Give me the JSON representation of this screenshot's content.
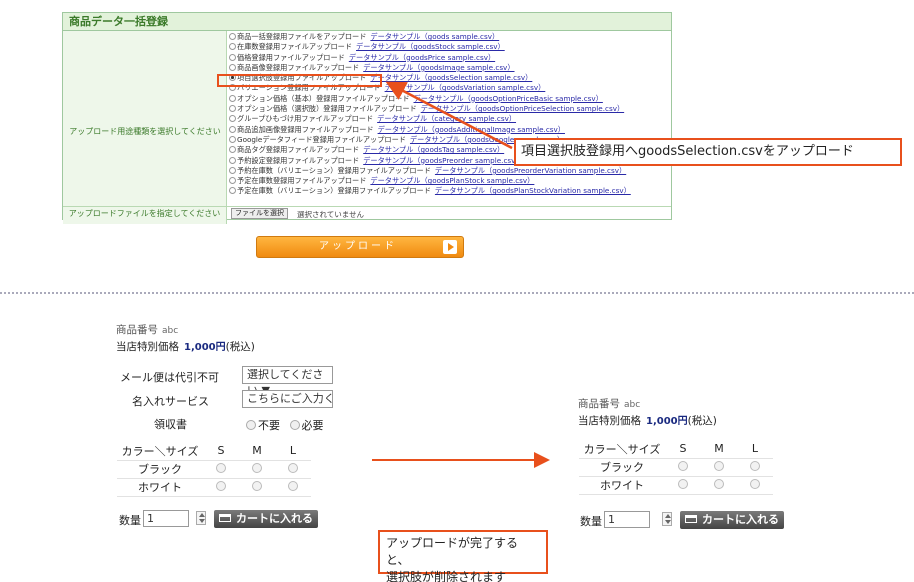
{
  "upload_panel": {
    "title": "商品データ一括登録",
    "type_label": "アップロード用途種類を選択してください",
    "options": [
      {
        "label": "商品一括登録用ファイルをアップロード",
        "link": "データサンプル（goods sample.csv）",
        "selected": false
      },
      {
        "label": "在庫数登録用ファイルアップロード",
        "link": "データサンプル（goodsStock sample.csv）",
        "selected": false
      },
      {
        "label": "価格登録用ファイルアップロード",
        "link": "データサンプル（goodsPrice sample.csv）",
        "selected": false
      },
      {
        "label": "商品画像登録用ファイルアップロード",
        "link": "データサンプル（goodsImage sample.csv）",
        "selected": false
      },
      {
        "label": "項目選択肢登録用ファイルアップロード",
        "link": "データサンプル（goodsSelection sample.csv）",
        "selected": true
      },
      {
        "label": "バリエーション登録用ファイルアップロード",
        "link": "データサンプル（goodsVariation sample.csv）",
        "selected": false
      },
      {
        "label": "オプション価格（基本）登録用ファイルアップロード",
        "link": "データサンプル（goodsOptionPriceBasic sample.csv）",
        "selected": false
      },
      {
        "label": "オプション価格（選択肢）登録用ファイルアップロード",
        "link": "データサンプル（goodsOptionPriceSelection sample.csv）",
        "selected": false
      },
      {
        "label": "グループひもづけ用ファイルアップロード",
        "link": "データサンプル（category sample.csv）",
        "selected": false
      },
      {
        "label": "商品追加画像登録用ファイルアップロード",
        "link": "データサンプル（goodsAdditionalImage sample.csv）",
        "selected": false
      },
      {
        "label": "Googleデータフィード登録用ファイルアップロード",
        "link": "データサンプル（goodsGoogle sample.csv）",
        "selected": false
      },
      {
        "label": "商品タグ登録用ファイルアップロード",
        "link": "データサンプル（goodsTag sample.csv）",
        "selected": false
      },
      {
        "label": "予約設定登録用ファイルアップロード",
        "link": "データサンプル（goodsPreorder sample.csv）",
        "selected": false
      },
      {
        "label": "予約在庫数（バリエーション）登録用ファイルアップロード",
        "link": "データサンプル（goodsPreorderVariation sample.csv）",
        "selected": false
      },
      {
        "label": "予定在庫数登録用ファイルアップロード",
        "link": "データサンプル（goodsPlanStock sample.csv）",
        "selected": false
      },
      {
        "label": "予定在庫数（バリエーション）登録用ファイルアップロード",
        "link": "データサンプル（goodsPlanStockVariation sample.csv）",
        "selected": false
      }
    ],
    "file_label": "アップロードファイルを指定してください",
    "file_button": "ファイルを選択",
    "file_status": "選択されていません",
    "upload_button": "アップロード"
  },
  "callout_top": "項目選択肢登録用へgoodsSelection.csvをアップロード",
  "callout_bottom": {
    "line1": "アップロードが完了すると、",
    "line2": "選択肢が削除されます"
  },
  "before": {
    "product_number_label": "商品番号",
    "product_number": "abc",
    "price_label": "当店特別価格",
    "price_value": "1,000円",
    "tax_note": "(税込)",
    "mail_label": "メール便は代引不可",
    "mail_select": "選択してください",
    "engrave_label": "名入れサービス",
    "engrave_value": "こちらにご入力くだ",
    "receipt_label": "領収書",
    "receipt_no": "不要",
    "receipt_yes": "必要",
    "matrix_header": "カラー＼サイズ",
    "sizes": [
      "S",
      "M",
      "L"
    ],
    "colors": [
      "ブラック",
      "ホワイト"
    ],
    "qty_label": "数量",
    "qty_value": "1",
    "cart_button": "カートに入れる"
  },
  "after": {
    "product_number_label": "商品番号",
    "product_number": "abc",
    "price_label": "当店特別価格",
    "price_value": "1,000円",
    "tax_note": "(税込)",
    "matrix_header": "カラー＼サイズ",
    "sizes": [
      "S",
      "M",
      "L"
    ],
    "colors": [
      "ブラック",
      "ホワイト"
    ],
    "qty_label": "数量",
    "qty_value": "1",
    "cart_button": "カートに入れる"
  },
  "colors": {
    "accent": "#e8501c",
    "panel_green": "#e2f2da",
    "link_blue": "#2a2aa8",
    "upload_orange": "#f08a10"
  }
}
